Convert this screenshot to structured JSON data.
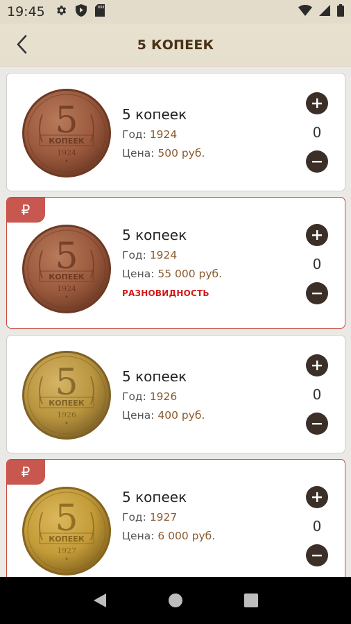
{
  "status_bar": {
    "time": "19:45",
    "left_icons": [
      "gear-icon",
      "shield-icon",
      "sd-card-icon"
    ],
    "right_icons": [
      "wifi-icon",
      "signal-icon",
      "battery-icon"
    ]
  },
  "header": {
    "title": "5 КОПЕЕК",
    "back_icon": "chevron-left-icon"
  },
  "labels": {
    "year": "Год:",
    "price": "Цена:",
    "rub_symbol": "₽"
  },
  "coins": [
    {
      "name": "5 копеек",
      "year": "1924",
      "price": "500 руб.",
      "count": "0",
      "variety": false,
      "variety_label": "",
      "coin_year_text": "1924",
      "colors": {
        "light": "#b87a5a",
        "mid": "#9b5a3e",
        "dark": "#6e3a24"
      }
    },
    {
      "name": "5 копеек",
      "year": "1924",
      "price": "55 000 руб.",
      "count": "0",
      "variety": true,
      "variety_label": "РАЗНОВИДНОСТЬ",
      "coin_year_text": "1924",
      "colors": {
        "light": "#b87a5a",
        "mid": "#9b5a3e",
        "dark": "#6e3a24"
      }
    },
    {
      "name": "5 копеек",
      "year": "1926",
      "price": "400 руб.",
      "count": "0",
      "variety": false,
      "variety_label": "",
      "coin_year_text": "1926",
      "colors": {
        "light": "#d6b466",
        "mid": "#b9953f",
        "dark": "#7e6125"
      }
    },
    {
      "name": "5 копеек",
      "year": "1927",
      "price": "6 000 руб.",
      "count": "0",
      "variety": true,
      "variety_label": "",
      "coin_year_text": "1927",
      "colors": {
        "light": "#dcb85c",
        "mid": "#c39b38",
        "dark": "#86651f"
      }
    }
  ],
  "coin_face": {
    "denomination": "5",
    "word": "КОПЕЕК"
  },
  "nav": {
    "back_icon": "triangle-back-icon",
    "home_icon": "circle-home-icon",
    "recents_icon": "square-recents-icon"
  },
  "colors": {
    "accent_dark": "#3b2f28",
    "variety_border": "#c9473f",
    "variety_text": "#d31a1a",
    "value_text": "#8a5a2c"
  }
}
